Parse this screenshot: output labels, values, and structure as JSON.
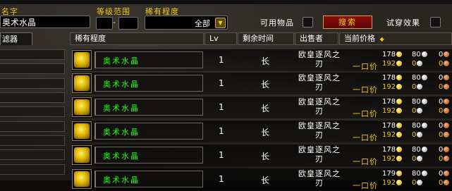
{
  "search": {
    "name_label": "名字",
    "name_value": "奥术水晶",
    "level_range_label": "等级范围",
    "level_separator": "-",
    "rarity_label": "稀有程度",
    "rarity_value": "全部",
    "usable_label": "可用物品",
    "search_button": "搜索",
    "preview_label": "试穿效果"
  },
  "sidebar": {
    "filter_tab": "滤器"
  },
  "columns": [
    "稀有程度",
    "Lv",
    "剩余时间",
    "出售者",
    "当前价格"
  ],
  "sort_indicator": "◆",
  "rows": [
    {
      "name": "奥术水晶",
      "level": "1",
      "time": "长",
      "seller": "欧皇逐风之刃",
      "bid_gold": "178",
      "bid_silver": "80",
      "bid_copper": "0",
      "buyout_label": "一口价",
      "buyout_gold": "192",
      "buyout_silver": "0",
      "buyout_copper": "0"
    },
    {
      "name": "奥术水晶",
      "level": "1",
      "time": "长",
      "seller": "欧皇逐风之刃",
      "bid_gold": "178",
      "bid_silver": "80",
      "bid_copper": "0",
      "buyout_label": "一口价",
      "buyout_gold": "192",
      "buyout_silver": "0",
      "buyout_copper": "0"
    },
    {
      "name": "奥术水晶",
      "level": "1",
      "time": "长",
      "seller": "欧皇逐风之刃",
      "bid_gold": "178",
      "bid_silver": "80",
      "bid_copper": "0",
      "buyout_label": "一口价",
      "buyout_gold": "192",
      "buyout_silver": "0",
      "buyout_copper": "0"
    },
    {
      "name": "奥术水晶",
      "level": "1",
      "time": "长",
      "seller": "欧皇逐风之刃",
      "bid_gold": "178",
      "bid_silver": "80",
      "bid_copper": "0",
      "buyout_label": "一口价",
      "buyout_gold": "192",
      "buyout_silver": "0",
      "buyout_copper": "0"
    },
    {
      "name": "奥术水晶",
      "level": "1",
      "time": "长",
      "seller": "欧皇逐风之刃",
      "bid_gold": "178",
      "bid_silver": "80",
      "bid_copper": "0",
      "buyout_label": "一口价",
      "buyout_gold": "192",
      "buyout_silver": "0",
      "buyout_copper": "0"
    },
    {
      "name": "奥术水晶",
      "level": "1",
      "time": "长",
      "seller": "欧皇逐风之刃",
      "bid_gold": "179",
      "bid_silver": "80",
      "bid_copper": "0",
      "buyout_label": "一口价",
      "buyout_gold": "192",
      "buyout_silver": "0",
      "buyout_copper": "0"
    }
  ]
}
